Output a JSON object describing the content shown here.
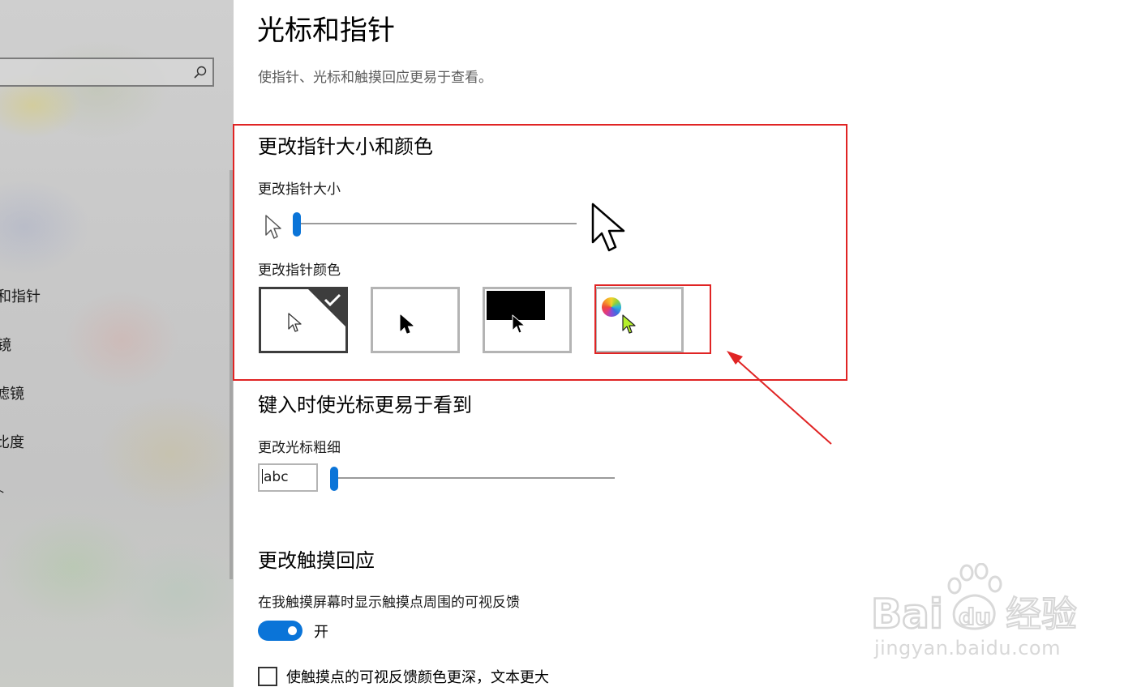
{
  "sidebar": {
    "search": {
      "placeholder": "",
      "value": ""
    },
    "items": [
      {
        "label": "和指针"
      },
      {
        "label": "镜"
      },
      {
        "label": "滤镜"
      },
      {
        "label": "比度"
      },
      {
        "label": "卜"
      }
    ]
  },
  "page": {
    "title": "光标和指针",
    "description": "使指针、光标和触摸回应更易于查看。"
  },
  "pointer_section": {
    "title": "更改指针大小和颜色",
    "size_label": "更改指针大小",
    "size_level": 0.0,
    "color_label": "更改指针颜色",
    "color_options": [
      {
        "name": "white",
        "selected": true
      },
      {
        "name": "black",
        "selected": false
      },
      {
        "name": "inverted",
        "selected": false
      },
      {
        "name": "custom",
        "selected": false
      }
    ]
  },
  "cursor_section": {
    "title": "键入时使光标更易于看到",
    "thickness_label": "更改光标粗细",
    "preview_text": "abc",
    "thickness_level": 0.0
  },
  "touch_section": {
    "title": "更改触摸回应",
    "feedback_label": "在我触摸屏幕时显示触摸点周围的可视反馈",
    "toggle_state": "开",
    "toggle_on": true,
    "darker_label": "使触摸点的可视反馈颜色更深，文本更大",
    "darker_checked": false
  },
  "watermark": {
    "brand": "Bai du 经验",
    "url": "jingyan.baidu.com"
  },
  "colors": {
    "accent": "#0a74d8",
    "annotation": "#e02424"
  }
}
